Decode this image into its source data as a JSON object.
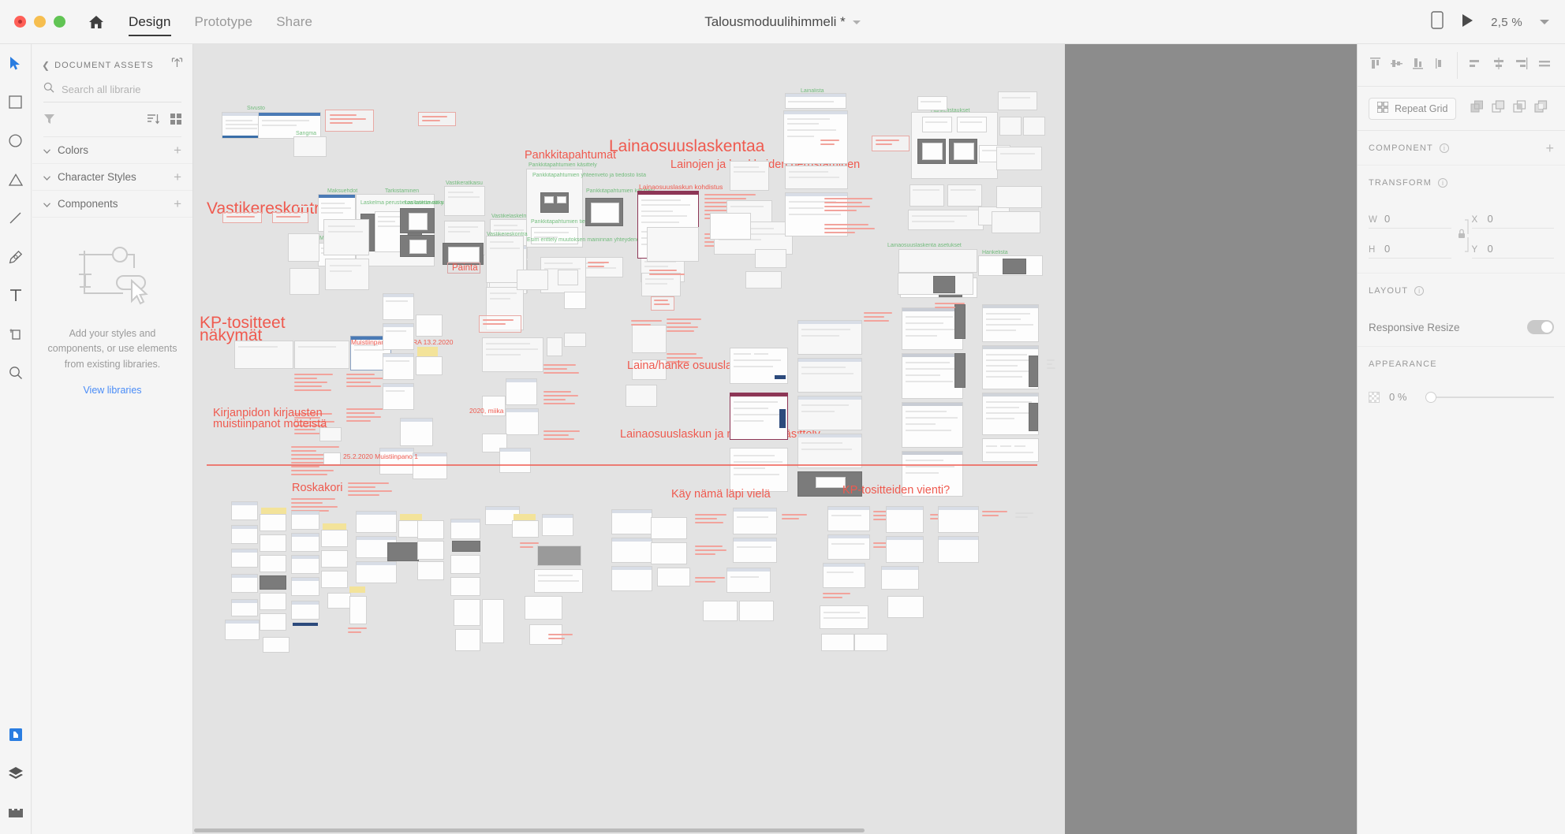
{
  "app": {
    "name": "Adobe XD",
    "document_title": "Talousmoduulihimmeli *",
    "zoom": "2,5 %"
  },
  "titlebar": {
    "window_controls": [
      "close",
      "minimize",
      "maximize"
    ],
    "home_icon": "home-icon",
    "tabs": [
      {
        "label": "Design",
        "active": true
      },
      {
        "label": "Prototype",
        "active": false
      },
      {
        "label": "Share",
        "active": false
      }
    ],
    "device_preview_icon": "phone-icon",
    "play_icon": "play-icon",
    "zoom_caret_icon": "chevron-down-icon"
  },
  "toolbar": {
    "tools": [
      {
        "name": "select-tool",
        "icon": "cursor-icon",
        "active": true
      },
      {
        "name": "rectangle-tool",
        "icon": "square-icon",
        "active": false
      },
      {
        "name": "ellipse-tool",
        "icon": "circle-icon",
        "active": false
      },
      {
        "name": "polygon-tool",
        "icon": "triangle-icon",
        "active": false
      },
      {
        "name": "line-tool",
        "icon": "line-icon",
        "active": false
      },
      {
        "name": "pen-tool",
        "icon": "pen-icon",
        "active": false
      },
      {
        "name": "text-tool",
        "icon": "text-t-icon",
        "active": false
      },
      {
        "name": "artboard-tool",
        "icon": "artboard-icon",
        "active": false
      },
      {
        "name": "zoom-tool",
        "icon": "magnifier-icon",
        "active": false
      }
    ],
    "bottom_tools": [
      {
        "name": "assets-panel-toggle",
        "icon": "assets-icon",
        "active": true
      },
      {
        "name": "layers-panel-toggle",
        "icon": "layers-icon",
        "active": false
      },
      {
        "name": "plugins-panel-toggle",
        "icon": "plugins-icon",
        "active": false
      }
    ]
  },
  "assets_panel": {
    "back_icon": "chevron-left-icon",
    "title": "DOCUMENT ASSETS",
    "publish_icon": "publish-icon",
    "search": {
      "icon": "search-icon",
      "value": "",
      "placeholder": "Search all librarie",
      "caret_icon": "chevron-down-icon"
    },
    "filter_icon": "filter-icon",
    "sort_icon": "sort-icon",
    "grid_icon": "grid-view-icon",
    "sections": [
      {
        "label": "Colors",
        "add": "+"
      },
      {
        "label": "Character Styles",
        "add": "+"
      },
      {
        "label": "Components",
        "add": "+"
      }
    ],
    "empty_state": {
      "illustration": "components-placeholder-icon",
      "text": "Add your styles and components, or use elements from existing libraries.",
      "link": "View libraries"
    }
  },
  "inspector": {
    "align_tools": [
      "align-top-icon",
      "align-vertical-center-icon",
      "align-bottom-icon",
      "align-left-edge-icon",
      "distribute-left-icon",
      "distribute-center-icon",
      "distribute-right-icon",
      "distribute-horizontal-icon"
    ],
    "repeat_grid_label": "Repeat Grid",
    "repeat_grid_icon": "repeat-grid-icon",
    "boolean_ops": [
      "add-icon",
      "subtract-icon",
      "intersect-icon",
      "exclude-icon"
    ],
    "component": {
      "title": "COMPONENT",
      "info_icon": "info-icon",
      "add": "+"
    },
    "transform": {
      "title": "TRANSFORM",
      "info_icon": "info-icon",
      "w_label": "W",
      "w_value": "0",
      "h_label": "H",
      "h_value": "0",
      "x_label": "X",
      "x_value": "0",
      "y_label": "Y",
      "y_value": "0",
      "lock_icon": "lock-icon"
    },
    "layout": {
      "title": "LAYOUT",
      "info_icon": "info-icon",
      "responsive_resize_label": "Responsive Resize",
      "responsive_resize_on": true
    },
    "appearance": {
      "title": "APPEARANCE",
      "opacity_value": "0 %",
      "opacity_swatch": "checker-swatch"
    }
  },
  "canvas": {
    "annotations": [
      {
        "id": "vastikereskontraa",
        "text": "Vastikereskontraa",
        "size": "big"
      },
      {
        "id": "pankkitapahtumat",
        "text": "Pankkitapahtumat",
        "size": "mid"
      },
      {
        "id": "lainaosuuslaskentaa",
        "text": "Lainaosuuslaskentaa",
        "size": "big"
      },
      {
        "id": "lainojen-ja-hankkeiden-perustaminen",
        "text": "Lainojen ja hankkeiden perustaminen",
        "size": "mid"
      },
      {
        "id": "kp-tositteet-nakymat-1",
        "text": "KP-tositteet",
        "size": "big"
      },
      {
        "id": "kp-tositteet-nakymat-2",
        "text": "näkymät",
        "size": "big"
      },
      {
        "id": "kirjanpidon-1",
        "text": "Kirjanpidon kirjausten",
        "size": "mid"
      },
      {
        "id": "kirjanpidon-2",
        "text": "muistiinpanot möteistä",
        "size": "mid"
      },
      {
        "id": "laina-hanke-osuuslaskun-luonti",
        "text": "Laina/hanke osuuslaskun luonti",
        "size": "mid"
      },
      {
        "id": "lainaosuuslaskun-ja-maksujen-kasittely",
        "text": "Lainaosuuslaskun ja maksujen käsittely",
        "size": "mid"
      },
      {
        "id": "roskakori",
        "text": "Roskakori",
        "size": "mid"
      },
      {
        "id": "kay-nama-lapi-viela",
        "text": "Käy nämä läpi vielä",
        "size": "mid"
      },
      {
        "id": "kp-tositteiden-vienti",
        "text": "KP-tositteiden vienti?",
        "size": "mid"
      },
      {
        "id": "painta",
        "text": "Painta",
        "size": "sm"
      },
      {
        "id": "note-1",
        "text": "Muistiinpano t.HAKARA 13.2.2020",
        "size": "tiny"
      },
      {
        "id": "note-2",
        "text": "25.2.2020 Muistiinpano 1",
        "size": "tiny"
      },
      {
        "id": "note-3",
        "text": "2020, miika",
        "size": "tiny"
      }
    ],
    "accent_color": "#ef5a4f",
    "artboard_bg": "#e3e3e3",
    "pasteboard_bg": "#8c8c8c"
  }
}
